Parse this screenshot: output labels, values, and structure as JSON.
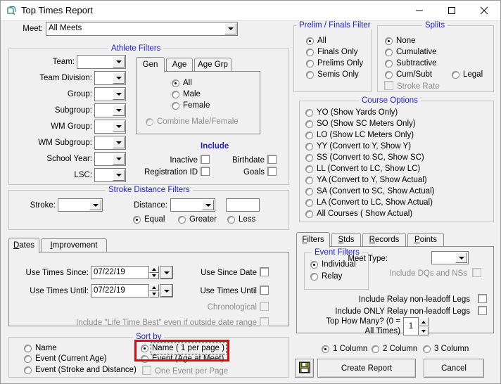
{
  "window": {
    "title": "Top Times Report",
    "icon": "report-window-icon",
    "minimize": "minimize-icon",
    "maximize": "maximize-icon",
    "close": "close-icon"
  },
  "meet": {
    "label": "Meet:",
    "value": "All Meets"
  },
  "athlete_filters": {
    "title": "Athlete Filters",
    "fields": [
      {
        "label": "Team:",
        "value": ""
      },
      {
        "label": "Team Division:",
        "value": ""
      },
      {
        "label": "Group:",
        "value": ""
      },
      {
        "label": "Subgroup:",
        "value": ""
      },
      {
        "label": "WM Group:",
        "value": ""
      },
      {
        "label": "WM Subgroup:",
        "value": ""
      },
      {
        "label": "School Year:",
        "value": ""
      },
      {
        "label": "LSC:",
        "value": ""
      }
    ],
    "tabs": [
      {
        "label": "Gen",
        "selected": true
      },
      {
        "label": "Age",
        "selected": false
      },
      {
        "label": "Age Grp",
        "selected": false
      }
    ],
    "gender_options": [
      {
        "label": "All",
        "checked": true,
        "disabled": false
      },
      {
        "label": "Male",
        "checked": false,
        "disabled": false
      },
      {
        "label": "Female",
        "checked": false,
        "disabled": false
      },
      {
        "label": "Combine Male/Female",
        "checked": false,
        "disabled": true
      }
    ],
    "include": {
      "title": "Include",
      "items": [
        {
          "label": "Inactive",
          "checked": false
        },
        {
          "label": "Birthdate",
          "checked": false
        },
        {
          "label": "Registration ID",
          "checked": false
        },
        {
          "label": "Goals",
          "checked": false
        }
      ]
    }
  },
  "prelim_finals_filter": {
    "title": "Prelim / Finals Filter",
    "options": [
      {
        "label": "All",
        "checked": true
      },
      {
        "label": "Finals Only",
        "checked": false
      },
      {
        "label": "Prelims Only",
        "checked": false
      },
      {
        "label": "Semis Only",
        "checked": false
      }
    ]
  },
  "splits": {
    "title": "Splits",
    "options": [
      {
        "label": "None",
        "checked": true
      },
      {
        "label": "Cumulative",
        "checked": false
      },
      {
        "label": "Subtractive",
        "checked": false
      },
      {
        "label": "Cum/Subt",
        "checked": false
      }
    ],
    "legal": {
      "label": "Legal",
      "checked": false
    },
    "stroke_rate": {
      "label": "Stroke Rate",
      "checked": false,
      "disabled": true
    }
  },
  "course_options": {
    "title": "Course Options",
    "options": [
      {
        "label": "YO (Show Yards Only)",
        "checked": false
      },
      {
        "label": "SO (Show SC Meters Only)",
        "checked": false
      },
      {
        "label": "LO (Show LC Meters Only)",
        "checked": false
      },
      {
        "label": "YY (Convert to Y, Show Y)",
        "checked": false
      },
      {
        "label": "SS (Convert to SC, Show SC)",
        "checked": false
      },
      {
        "label": "LL (Convert to LC, Show LC)",
        "checked": false
      },
      {
        "label": "YA (Convert to Y, Show Actual)",
        "checked": false
      },
      {
        "label": "SA (Convert to SC, Show Actual)",
        "checked": false
      },
      {
        "label": "LA (Convert to LC, Show Actual)",
        "checked": false
      },
      {
        "label": "All Courses ( Show Actual)",
        "checked": false
      }
    ]
  },
  "stroke_distance_filters": {
    "title": "Stroke Distance Filters",
    "stroke_label": "Stroke:",
    "stroke_value": "",
    "distance_label": "Distance:",
    "distance_value": "",
    "distance_text": "",
    "comparison": [
      {
        "label": "Equal",
        "checked": true
      },
      {
        "label": "Greater",
        "checked": false
      },
      {
        "label": "Less",
        "checked": false
      }
    ]
  },
  "dates_tabs": [
    {
      "label": "Dates",
      "accel": "D",
      "selected": true
    },
    {
      "label": "Improvement",
      "accel": "I",
      "selected": false
    }
  ],
  "dates_panel": {
    "use_times_since_label": "Use Times Since:",
    "use_times_since_value": "07/22/19",
    "use_times_until_label": "Use Times Until:",
    "use_times_until_value": "07/22/19",
    "checks": [
      {
        "label": "Use Since Date",
        "checked": false,
        "disabled": false
      },
      {
        "label": "Use Times Until",
        "checked": false,
        "disabled": false
      },
      {
        "label": "Chronological",
        "checked": false,
        "disabled": true
      },
      {
        "label": "Include \"Life Time Best\" even if outside date range",
        "checked": false,
        "disabled": true
      }
    ]
  },
  "sort_by": {
    "title": "Sort by",
    "left_options": [
      {
        "label": "Name",
        "checked": false
      },
      {
        "label": "Event (Current Age)",
        "checked": false
      },
      {
        "label": "Event (Stroke and Distance)",
        "checked": false
      }
    ],
    "right_options": [
      {
        "label": "Name ( 1 per page )",
        "checked": true,
        "highlighted": true
      },
      {
        "label": "Event  (Age at Meet)",
        "checked": false,
        "highlighted": false
      }
    ],
    "one_event_per_page": {
      "label": "One Event per Page",
      "checked": false,
      "disabled": true
    }
  },
  "right_tabs": [
    {
      "label": "Filters",
      "accel": "F",
      "selected": true
    },
    {
      "label": "Stds",
      "accel": "S",
      "selected": false
    },
    {
      "label": "Records",
      "accel": "R",
      "selected": false
    },
    {
      "label": "Points",
      "accel": "P",
      "selected": false
    }
  ],
  "event_filters": {
    "title": "Event Filters",
    "options": [
      {
        "label": "Individual",
        "checked": true
      },
      {
        "label": "Relay",
        "checked": false
      }
    ]
  },
  "meet_type": {
    "label": "Meet Type:",
    "value": ""
  },
  "include_dqs": {
    "label": "Include DQs and NSs",
    "checked": false,
    "disabled": true
  },
  "relay_checks": [
    {
      "label": "Include Relay non-leadoff  Legs",
      "checked": false
    },
    {
      "label": "Include ONLY Relay non-leadoff Legs",
      "checked": false
    }
  ],
  "top_how_many": {
    "label_line1": "Top How Many?  (0 =",
    "label_line2": "All Times)",
    "value": "1"
  },
  "columns": [
    {
      "label": "1 Column",
      "checked": true
    },
    {
      "label": "2 Column",
      "checked": false
    },
    {
      "label": "3 Column",
      "checked": false
    }
  ],
  "actions": {
    "save_icon": "floppy-disk-save-icon",
    "create_report": "Create Report",
    "cancel": "Cancel"
  },
  "colors": {
    "group_title": "#2222cc",
    "face": "#f0f0f0",
    "highlight_box": "#ee0000"
  }
}
